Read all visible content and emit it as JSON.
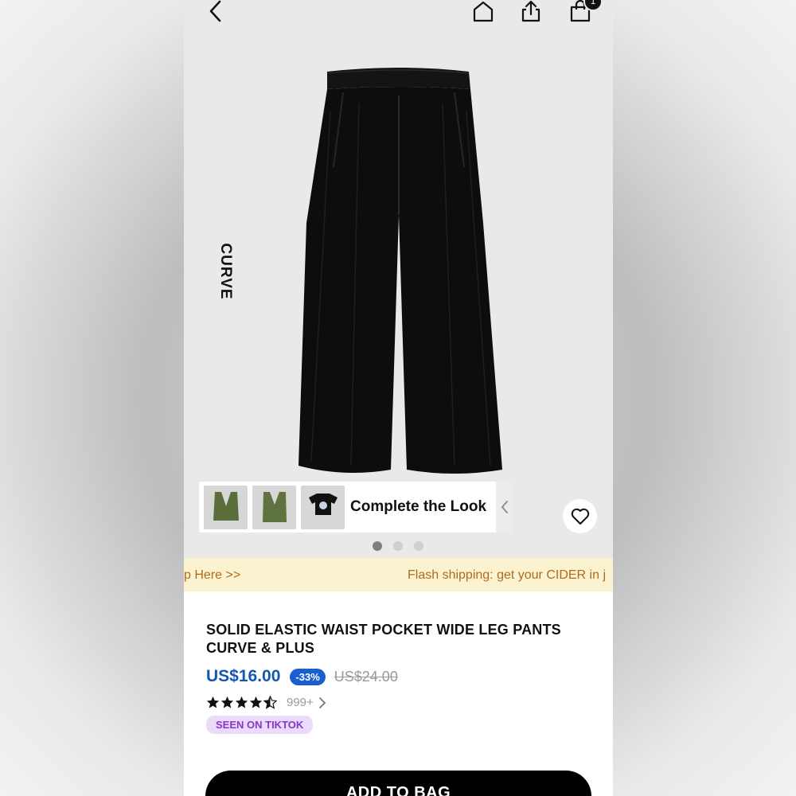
{
  "header": {
    "back_icon": "chevron-left-icon",
    "home_icon": "home-icon",
    "share_icon": "share-icon",
    "bag_icon": "shopping-bag-icon",
    "bag_count": "1"
  },
  "gallery": {
    "side_label": "CURVE",
    "product_image": "black wide leg pants",
    "complete_look": {
      "title": "Complete the Look",
      "items": [
        "green vest",
        "green top",
        "black graphic tee"
      ]
    },
    "wishlist_icon": "heart-icon",
    "page_dots": 3,
    "active_dot": 0
  },
  "promo": {
    "left_text": "p Here >>",
    "right_text": "Flash shipping: get your CIDER in j"
  },
  "product": {
    "title": "SOLID ELASTIC WAIST POCKET WIDE LEG PANTS CURVE & PLUS",
    "price": "US$16.00",
    "discount": "-33%",
    "original_price": "US$24.00",
    "rating": 4.5,
    "review_count": "999+",
    "tag": "SEEN ON TIKTOK"
  },
  "actions": {
    "add_to_bag": "ADD TO BAG"
  },
  "colors": {
    "price": "#1557b0",
    "discount_badge": "#1a5fd0",
    "promo_bg": "#fbf3cf",
    "promo_text": "#b06a1c",
    "tag_bg": "#eadbfa",
    "tag_text": "#8a35c9"
  }
}
